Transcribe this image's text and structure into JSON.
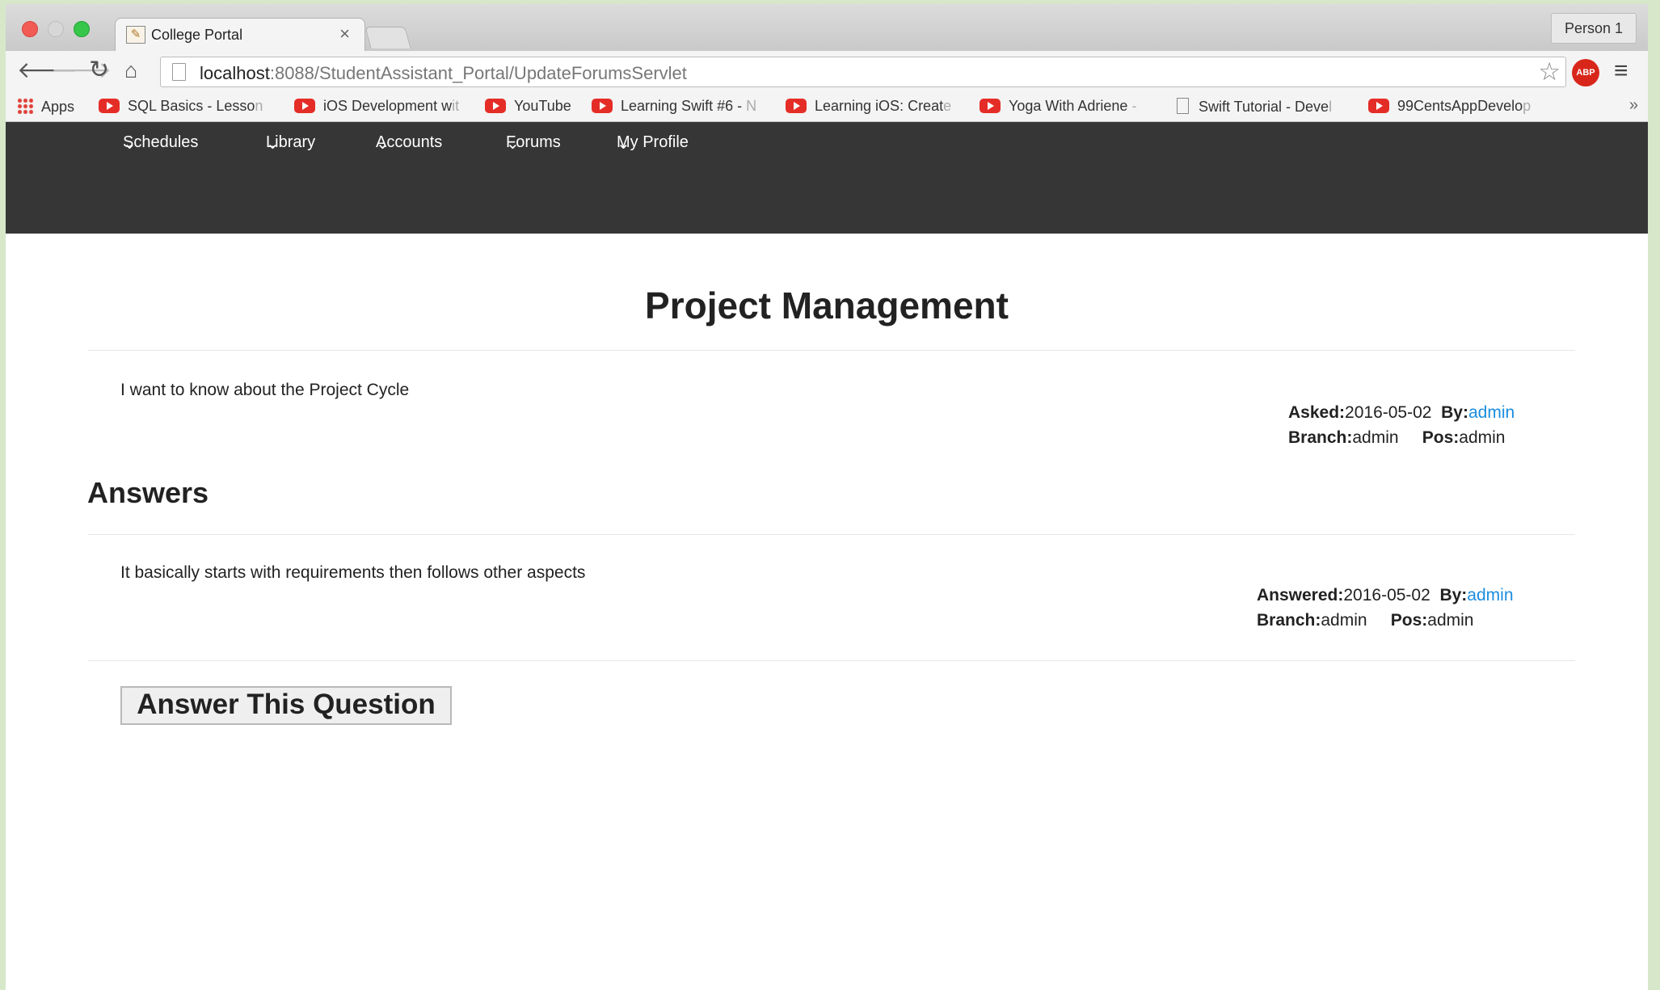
{
  "browser": {
    "tab_title": "College Portal",
    "tab_close": "×",
    "profile": "Person 1",
    "url_host": "localhost",
    "url_rest": ":8088/StudentAssistant_Portal/UpdateForumsServlet",
    "adblock_label": "ABP",
    "bookmarks": [
      {
        "label": "Apps",
        "fade": ""
      },
      {
        "label": "SQL Basics - Lesso",
        "fade": "n"
      },
      {
        "label": "iOS Development w",
        "fade": "it"
      },
      {
        "label": "YouTube",
        "fade": ""
      },
      {
        "label": "Learning Swift #6 - ",
        "fade": "N"
      },
      {
        "label": "Learning iOS: Creat",
        "fade": "e"
      },
      {
        "label": "Yoga With Adriene ",
        "fade": "-"
      },
      {
        "label": "Swift Tutorial - Deve",
        "fade": "l"
      },
      {
        "label": "99CentsAppDevelo",
        "fade": "p"
      }
    ],
    "bookmarks_more": "»"
  },
  "site_nav": [
    "Schedules",
    "Library",
    "Accounts",
    "Forums",
    "My Profile"
  ],
  "question": {
    "title": "Project Management",
    "text": "I want to know about the Project Cycle",
    "asked_label": "Asked:",
    "asked_date": "2016-05-02",
    "by_label": "By:",
    "by_user": "admin",
    "branch_label": "Branch:",
    "branch": "admin",
    "pos_label": "Pos:",
    "pos": "admin"
  },
  "answers_heading": "Answers",
  "answers": [
    {
      "text": "It basically starts with requirements then follows other aspects",
      "answered_label": "Answered:",
      "answered_date": "2016-05-02",
      "by_label": "By:",
      "by_user": "admin",
      "branch_label": "Branch:",
      "branch": "admin",
      "pos_label": "Pos:",
      "pos": "admin"
    }
  ],
  "answer_button": "Answer This Question",
  "colors": {
    "header_bg": "#363636",
    "link": "#1a8de0"
  }
}
